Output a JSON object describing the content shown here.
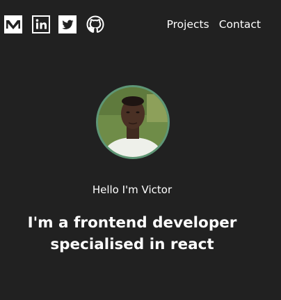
{
  "social": {
    "links": [
      {
        "name": "medium-icon"
      },
      {
        "name": "linkedin-icon"
      },
      {
        "name": "twitter-icon"
      },
      {
        "name": "github-icon"
      }
    ]
  },
  "nav": {
    "projects_label": "Projects",
    "contact_label": "Contact"
  },
  "hero": {
    "greeting": "Hello I'm Victor",
    "headline_line1": "I'm a frontend developer",
    "headline_line2": "specialised in react"
  },
  "colors": {
    "background": "#212121",
    "avatar_ring": "#5e9676",
    "text": "#ffffff"
  }
}
